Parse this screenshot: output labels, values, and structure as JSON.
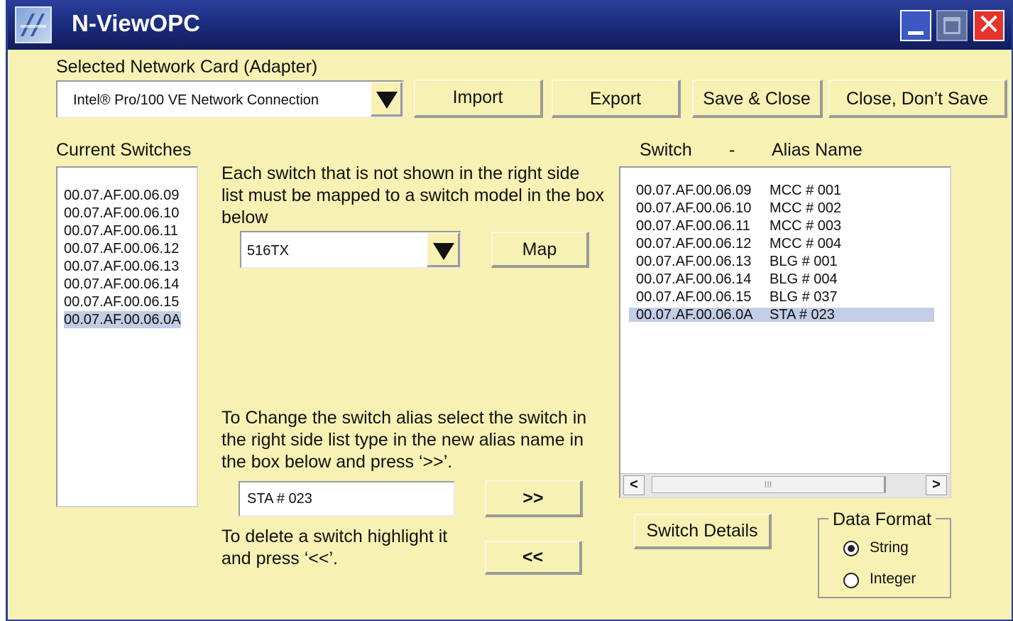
{
  "window": {
    "title": "N-ViewOPC"
  },
  "adapter": {
    "label": "Selected Network Card (Adapter)",
    "value": "Intel® Pro/100 VE Network Connection"
  },
  "buttons": {
    "import": "Import",
    "export": "Export",
    "save_close": "Save & Close",
    "close_no_save": "Close, Don’t Save",
    "map": "Map",
    "add_alias": ">>",
    "delete": "<<",
    "switch_details": "Switch Details"
  },
  "current_switches": {
    "label": "Current Switches",
    "items": [
      "00.07.AF.00.06.09",
      "00.07.AF.00.06.10",
      "00.07.AF.00.06.11",
      "00.07.AF.00.06.12",
      "00.07.AF.00.06.13",
      "00.07.AF.00.06.14",
      "00.07.AF.00.06.15",
      "00.07.AF.00.06.0A"
    ],
    "selected_index": 7
  },
  "instructions": {
    "map_text": "Each switch that is not shown in the right side list must be mapped to a switch model in the box below",
    "alias_text": "To Change the switch alias select the switch in the right side list type in the new alias name in the box below and press ‘>>’.",
    "delete_text": "To delete a switch highlight it and press ‘<<’."
  },
  "model_select": {
    "value": "516TX"
  },
  "alias_input": {
    "value": "STA # 023"
  },
  "alias_list": {
    "header_switch": "Switch",
    "header_sep": "-",
    "header_alias": "Alias Name",
    "rows": [
      {
        "switch": "00.07.AF.00.06.09",
        "alias": "MCC # 001"
      },
      {
        "switch": "00.07.AF.00.06.10",
        "alias": "MCC # 002"
      },
      {
        "switch": "00.07.AF.00.06.11",
        "alias": "MCC # 003"
      },
      {
        "switch": "00.07.AF.00.06.12",
        "alias": "MCC # 004"
      },
      {
        "switch": "00.07.AF.00.06.13",
        "alias": "BLG # 001"
      },
      {
        "switch": "00.07.AF.00.06.14",
        "alias": "BLG # 004"
      },
      {
        "switch": "00.07.AF.00.06.15",
        "alias": "BLG # 037"
      },
      {
        "switch": "00.07.AF.00.06.0A",
        "alias": "STA # 023"
      }
    ],
    "selected_index": 7,
    "scroll_left": "<",
    "scroll_right": ">",
    "scroll_grip": "III"
  },
  "data_format": {
    "label": "Data Format",
    "options": [
      "String",
      "Integer"
    ],
    "selected": "String"
  },
  "icons": [
    "app-logo-icon",
    "minimize-icon",
    "maximize-icon",
    "close-icon",
    "dropdown-arrow-icon"
  ],
  "colors": {
    "titlebar": "#1f2f86",
    "panel": "#f7f1b3",
    "selection": "#c3cde6",
    "close": "#e3332a"
  }
}
